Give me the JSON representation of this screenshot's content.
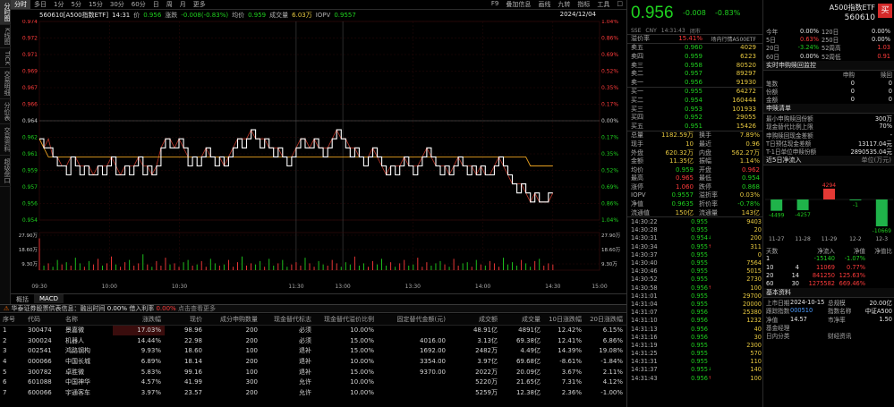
{
  "vtabs": [
    {
      "label": "分时图",
      "active": true
    },
    {
      "label": "K线图",
      "active": false
    },
    {
      "label": "TICK",
      "active": false
    },
    {
      "label": "交易明细",
      "active": false
    },
    {
      "label": "分价表",
      "active": false
    },
    {
      "label": "交易资料",
      "active": false
    },
    {
      "label": "超级盘口",
      "active": false
    }
  ],
  "periods": [
    "分时",
    "多日",
    "1分",
    "5分",
    "15分",
    "30分",
    "60分",
    "日",
    "周",
    "月",
    "更多"
  ],
  "right_tools": [
    "F9",
    "叠加信息",
    "画线",
    "九转",
    "指标",
    "工具",
    "□"
  ],
  "info": {
    "code_name": "560610[A500指数ETF]",
    "time": "14:31",
    "price_label": "价",
    "price": "0.956",
    "change_label": "涨跌",
    "change": "-0.008(-0.83%)",
    "avg_label": "均价",
    "avg": "0.959",
    "volume_label": "成交量",
    "volume": "6.03万",
    "iopv_label": "IOPV",
    "iopv": "0.9557",
    "date": "2024/12/04"
  },
  "chart_data": {
    "type": "line",
    "title": "",
    "prev_close": 0.964,
    "ylim": [
      0.953,
      0.975
    ],
    "y_ticks_left": [
      "0.974",
      "0.972",
      "0.971",
      "0.969",
      "0.967",
      "0.966",
      "0.964",
      "0.962",
      "0.961",
      "0.959",
      "0.957",
      "0.956",
      "0.954"
    ],
    "y_ticks_right": [
      "1.04%",
      "0.86%",
      "0.69%",
      "0.52%",
      "0.35%",
      "0.17%",
      "0.00%",
      "0.17%",
      "0.35%",
      "0.52%",
      "0.69%",
      "0.86%",
      "1.04%"
    ],
    "x_ticks": [
      "09:30",
      "10:00",
      "10:30",
      "11:30",
      "13:00",
      "13:30",
      "14:00",
      "14:30",
      "15:00"
    ],
    "volume_ticks_left": [
      "27.90万",
      "18.60万",
      "9.30万"
    ],
    "volume_ticks_right": [
      "27.90万",
      "18.60万",
      "9.30万"
    ],
    "price_series": [
      0.962,
      0.961,
      0.961,
      0.96,
      0.959,
      0.959,
      0.958,
      0.96,
      0.959,
      0.958,
      0.959,
      0.958,
      0.958,
      0.959,
      0.958,
      0.959,
      0.96,
      0.958,
      0.958,
      0.959,
      0.958,
      0.959,
      0.96,
      0.958,
      0.959,
      0.958,
      0.959,
      0.961,
      0.962,
      0.961,
      0.961,
      0.962,
      0.961,
      0.959,
      0.96,
      0.959,
      0.96,
      0.961,
      0.96,
      0.959,
      0.96,
      0.959,
      0.96,
      0.961,
      0.962,
      0.961,
      0.962,
      0.963,
      0.962,
      0.961,
      0.962,
      0.961,
      0.96,
      0.961,
      0.96,
      0.959,
      0.96,
      0.961,
      0.962,
      0.961,
      0.961,
      0.962,
      0.961,
      0.96,
      0.961,
      0.962,
      0.963,
      0.962,
      0.961,
      0.96,
      0.961,
      0.96,
      0.959,
      0.96,
      0.961,
      0.96,
      0.959,
      0.958,
      0.959,
      0.958,
      0.959,
      0.96,
      0.959,
      0.958,
      0.959,
      0.96,
      0.961,
      0.96,
      0.959,
      0.958,
      0.959,
      0.958,
      0.959,
      0.96,
      0.959,
      0.958,
      0.959,
      0.958,
      0.959,
      0.958,
      0.958,
      0.959,
      0.96,
      0.959,
      0.958,
      0.957,
      0.956,
      0.957,
      0.956,
      0.955,
      0.956,
      0.955,
      0.955,
      0.956,
      0.956
    ],
    "avg_series": [
      0.962,
      0.961,
      0.96,
      0.96,
      0.96,
      0.96,
      0.96,
      0.96,
      0.96,
      0.96,
      0.96,
      0.96,
      0.96,
      0.96,
      0.96,
      0.96,
      0.96,
      0.96,
      0.96,
      0.96,
      0.96,
      0.96,
      0.96,
      0.96,
      0.96,
      0.96,
      0.96,
      0.96,
      0.96,
      0.96,
      0.96,
      0.96,
      0.96,
      0.96,
      0.96,
      0.96,
      0.96,
      0.96,
      0.96,
      0.96,
      0.96,
      0.96,
      0.96,
      0.96,
      0.96,
      0.96,
      0.96,
      0.96,
      0.96,
      0.96,
      0.96,
      0.96,
      0.96,
      0.96,
      0.96,
      0.96,
      0.96,
      0.96,
      0.96,
      0.96,
      0.96,
      0.96,
      0.96,
      0.96,
      0.96,
      0.96,
      0.96,
      0.96,
      0.96,
      0.96,
      0.96,
      0.96,
      0.96,
      0.96,
      0.96,
      0.96,
      0.96,
      0.96,
      0.96,
      0.96,
      0.96,
      0.96,
      0.96,
      0.96,
      0.96,
      0.96,
      0.96,
      0.96,
      0.96,
      0.96,
      0.96,
      0.96,
      0.96,
      0.96,
      0.96,
      0.96,
      0.96,
      0.96,
      0.96,
      0.96,
      0.96,
      0.96,
      0.96,
      0.96,
      0.96,
      0.96,
      0.96,
      0.96,
      0.96,
      0.959,
      0.959,
      0.959,
      0.959,
      0.959,
      0.959
    ],
    "iopv_series": [
      0.962,
      0.961,
      0.962,
      0.96,
      0.96,
      0.959,
      0.959,
      0.96,
      0.96,
      0.959,
      0.959,
      0.959,
      0.958,
      0.959,
      0.959,
      0.959,
      0.96,
      0.959,
      0.958,
      0.959,
      0.959,
      0.959,
      0.96,
      0.959,
      0.959,
      0.958,
      0.959,
      0.961,
      0.962,
      0.962,
      0.961,
      0.962,
      0.961,
      0.96,
      0.96,
      0.96,
      0.96,
      0.961,
      0.96,
      0.96,
      0.96,
      0.959,
      0.96,
      0.961,
      0.962,
      0.962,
      0.962,
      0.963,
      0.962,
      0.962,
      0.962,
      0.961,
      0.961,
      0.961,
      0.96,
      0.96,
      0.96,
      0.961,
      0.962,
      0.962,
      0.961,
      0.962,
      0.961,
      0.961,
      0.961,
      0.962,
      0.963,
      0.962,
      0.962,
      0.961,
      0.961,
      0.96,
      0.96,
      0.96,
      0.961,
      0.96,
      0.959,
      0.958,
      0.959,
      0.959,
      0.959,
      0.96,
      0.959,
      0.959,
      0.959,
      0.96,
      0.961,
      0.96,
      0.959,
      0.959,
      0.959,
      0.958,
      0.959,
      0.96,
      0.959,
      0.959,
      0.959,
      0.958,
      0.959,
      0.958,
      0.958,
      0.959,
      0.96,
      0.959,
      0.958,
      0.957,
      0.957,
      0.957,
      0.956,
      0.955,
      0.956,
      0.955,
      0.955,
      0.955,
      0.956
    ],
    "volume_series": [
      28,
      4,
      6,
      3,
      9,
      5,
      7,
      4,
      11,
      6,
      3,
      8,
      5,
      10,
      4,
      6,
      12,
      5,
      3,
      7,
      9,
      4,
      6,
      14,
      5,
      3,
      8,
      4,
      11,
      5,
      6,
      3,
      7,
      9,
      4,
      5,
      8,
      3,
      10,
      6,
      4,
      5,
      9,
      3,
      7,
      12,
      4,
      6,
      5,
      8,
      3,
      10,
      4,
      6,
      9,
      3,
      5,
      7,
      4,
      11,
      6,
      3,
      8,
      5,
      4,
      9,
      6,
      3,
      7,
      5,
      12,
      4,
      6,
      3,
      8,
      5,
      10,
      4,
      7,
      3,
      6,
      9,
      4,
      5,
      11,
      3,
      7,
      4,
      6,
      8,
      5,
      3,
      10,
      4,
      6,
      7,
      3,
      9,
      5,
      4,
      8,
      6,
      3,
      11,
      5,
      7,
      4,
      9,
      6,
      3,
      8,
      10,
      4,
      6,
      5
    ]
  },
  "bottom_tabs": [
    {
      "label": "概括",
      "active": false
    },
    {
      "label": "MACD",
      "active": true
    }
  ],
  "cons_bar": {
    "title": "华泰证券股票供表信息：融出时间",
    "v1_label": "融出时间",
    "v1": "0.00%",
    "v2_label": "借入利率",
    "v2": "0.00%",
    "v3": "点击查看更多"
  },
  "cons_headers": [
    "序号",
    "代码",
    "名称",
    "涨跌幅",
    "现价",
    "成分申购数量",
    "现金替代标志",
    "现金替代溢价比例",
    "固定替代金额(元)",
    "成交额",
    "成交量",
    "10日涨跌幅",
    "20日涨跌幅"
  ],
  "cons_rows": [
    [
      "1",
      "300474",
      "景嘉微",
      "17.03%",
      "98.96",
      "200",
      "必须",
      "10.00%",
      "",
      "48.91亿",
      "4891亿",
      "12.42%",
      "6.15%"
    ],
    [
      "2",
      "300024",
      "机器人",
      "14.44%",
      "22.98",
      "200",
      "必须",
      "15.00%",
      "4016.00",
      "3.13亿",
      "69.38亿",
      "12.41%",
      "6.86%"
    ],
    [
      "3",
      "002541",
      "鸿路钢构",
      "9.93%",
      "18.60",
      "100",
      "退补",
      "15.00%",
      "1692.00",
      "2482万",
      "4.49亿",
      "14.39%",
      "19.08%"
    ],
    [
      "4",
      "000066",
      "中国长城",
      "6.89%",
      "18.14",
      "200",
      "退补",
      "10.00%",
      "3354.00",
      "3.97亿",
      "69.68亿",
      "-8.61%",
      "-1.84%"
    ],
    [
      "5",
      "300782",
      "卓胜微",
      "5.83%",
      "99.16",
      "100",
      "退补",
      "15.00%",
      "9370.00",
      "2022万",
      "20.09亿",
      "3.67%",
      "2.11%"
    ],
    [
      "6",
      "601088",
      "中国神华",
      "4.57%",
      "41.99",
      "300",
      "允许",
      "10.00%",
      "",
      "5220万",
      "21.65亿",
      "7.31%",
      "4.12%"
    ],
    [
      "7",
      "600066",
      "宇通客车",
      "3.97%",
      "23.57",
      "200",
      "允许",
      "10.00%",
      "",
      "5259万",
      "12.38亿",
      "2.36%",
      "-1.00%"
    ]
  ],
  "quote": {
    "price": "0.956",
    "change": "-0.008",
    "pct": "-0.83%",
    "name": "A500指数ETF",
    "code": "560610",
    "buy_label": "买",
    "meta": [
      "SSE",
      "CNY",
      "14:31:43",
      "闭市"
    ],
    "premium_label": "溢价率",
    "premium": "15.41%",
    "linked_label": "场内行情A500ETF",
    "linked_val": "99131",
    "asks": [
      {
        "label": "卖五",
        "price": "0.960",
        "vol": "4029"
      },
      {
        "label": "卖四",
        "price": "0.959",
        "vol": "6223"
      },
      {
        "label": "卖三",
        "price": "0.958",
        "vol": "80520"
      },
      {
        "label": "卖二",
        "price": "0.957",
        "vol": "89297"
      },
      {
        "label": "卖一",
        "price": "0.956",
        "vol": "91930"
      }
    ],
    "bids": [
      {
        "label": "买一",
        "price": "0.955",
        "vol": "64272"
      },
      {
        "label": "买二",
        "price": "0.954",
        "vol": "160444"
      },
      {
        "label": "买三",
        "price": "0.953",
        "vol": "101933"
      },
      {
        "label": "买四",
        "price": "0.952",
        "vol": "29055"
      },
      {
        "label": "买五",
        "price": "0.951",
        "vol": "15426"
      }
    ],
    "stats": [
      {
        "l1": "总量",
        "v1": "1182.59万",
        "l2": "换手",
        "v2": "7.89%"
      },
      {
        "l1": "现手",
        "v1": "10",
        "l2": "最近",
        "v2": "0.96"
      },
      {
        "l1": "外盘",
        "v1": "620.32万",
        "l2": "内盘",
        "v2": "562.27万"
      },
      {
        "l1": "金额",
        "v1": "11.35亿",
        "l2": "振幅",
        "v2": "1.14%"
      },
      {
        "l1": "均价",
        "v1": "0.959",
        "l2": "开盘",
        "v2": "0.962"
      },
      {
        "l1": "最高",
        "v1": "0.965",
        "l2": "最低",
        "v2": "0.954"
      },
      {
        "l1": "涨停",
        "v1": "1.060",
        "l2": "跌停",
        "v2": "0.868"
      },
      {
        "l1": "IOPV",
        "v1": "0.9557",
        "l2": "溢折率",
        "v2": "0.03%"
      },
      {
        "l1": "净值",
        "v1": "0.9635",
        "l2": "折价率",
        "v2": "-0.78%"
      },
      {
        "l1": "流通值",
        "v1": "150亿",
        "l2": "流通量",
        "v2": "143亿"
      }
    ],
    "ticks": [
      {
        "t": "14:30:22",
        "p": "0.955",
        "v": "9403",
        "d": ""
      },
      {
        "t": "14:30:28",
        "p": "0.955",
        "v": "20",
        "d": ""
      },
      {
        "t": "14:30:31",
        "p": "0.954",
        "v": "200",
        "d": "down"
      },
      {
        "t": "14:30:34",
        "p": "0.955",
        "v": "311",
        "d": "up"
      },
      {
        "t": "14:30:37",
        "p": "0.955",
        "v": "0",
        "d": ""
      },
      {
        "t": "14:30:40",
        "p": "0.955",
        "v": "7564",
        "d": ""
      },
      {
        "t": "14:30:46",
        "p": "0.955",
        "v": "5015",
        "d": ""
      },
      {
        "t": "14:30:52",
        "p": "0.955",
        "v": "2730",
        "d": ""
      },
      {
        "t": "14:30:58",
        "p": "0.956",
        "v": "100",
        "d": "up"
      },
      {
        "t": "14:31:01",
        "p": "0.955",
        "v": "29700",
        "d": ""
      },
      {
        "t": "14:31:04",
        "p": "0.955",
        "v": "20000",
        "d": ""
      },
      {
        "t": "14:31:07",
        "p": "0.956",
        "v": "25380",
        "d": ""
      },
      {
        "t": "14:31:10",
        "p": "0.956",
        "v": "1232",
        "d": ""
      },
      {
        "t": "14:31:13",
        "p": "0.956",
        "v": "40",
        "d": ""
      },
      {
        "t": "14:31:16",
        "p": "0.956",
        "v": "30",
        "d": ""
      },
      {
        "t": "14:31:19",
        "p": "0.955",
        "v": "2300",
        "d": ""
      },
      {
        "t": "14:31:25",
        "p": "0.955",
        "v": "570",
        "d": ""
      },
      {
        "t": "14:31:31",
        "p": "0.955",
        "v": "110",
        "d": ""
      },
      {
        "t": "14:31:37",
        "p": "0.955",
        "v": "140",
        "d": "down"
      },
      {
        "t": "14:31:43",
        "p": "0.956",
        "v": "100",
        "d": "up"
      }
    ]
  },
  "perf": {
    "rows": [
      {
        "a": "今年",
        "b": "0.00%",
        "c": "120日",
        "d": "0.00%"
      },
      {
        "a": "5日",
        "b": "0.63%",
        "c": "250日",
        "d": "0.00%"
      },
      {
        "a": "20日",
        "b": "-3.24%",
        "c": "52周高",
        "d": "1.03"
      },
      {
        "a": "60日",
        "b": "0.00%",
        "c": "52周低",
        "d": "0.91"
      }
    ]
  },
  "flows": {
    "title": "实时申购赎回监控",
    "headers": [
      "",
      "申购",
      "赎回"
    ],
    "rows": [
      {
        "l": "笔数",
        "a": "0",
        "b": "0"
      },
      {
        "l": "份额",
        "a": "0",
        "b": "0"
      },
      {
        "l": "金额",
        "a": "0",
        "b": "0"
      }
    ]
  },
  "subs": {
    "title": "申赎清单",
    "rows": [
      {
        "l": "最小申购赎回份额",
        "v": "300万"
      },
      {
        "l": "现金替代比例上限",
        "v": "70%"
      },
      {
        "l": "申购赎回现金差额",
        "v": "-"
      },
      {
        "l": "T日预估现金差额",
        "v": "13117.04元"
      },
      {
        "l": "T-1日单位申赎份额",
        "v": "2890535.04元"
      }
    ]
  },
  "netflow": {
    "title": "近5日净流入",
    "unit": "单位(万元)",
    "days": [
      "11-27",
      "11-28",
      "11-29",
      "12-2",
      "12-3"
    ],
    "values": [
      -4499,
      -4257,
      4294,
      -1,
      -10669
    ],
    "value_labels": [
      "-4499",
      "-4257",
      "4294",
      "-1",
      "-10669"
    ]
  },
  "stat_table": {
    "headers": [
      "天数",
      "",
      "净流入",
      "净值",
      "净值比"
    ],
    "rows": [
      [
        "1",
        "",
        "-15140",
        "-1.07%",
        ""
      ],
      [
        "10",
        "4",
        "11069",
        "0.77%",
        ""
      ],
      [
        "20",
        "14",
        "841250",
        "125.63%",
        ""
      ],
      [
        "60",
        "30",
        "1275582",
        "669.46%",
        ""
      ]
    ]
  },
  "basic": {
    "title": "基本资料",
    "rows": [
      {
        "l": "上市日期",
        "v": "2024-10-15",
        "l2": "总规模",
        "v2": "20.00亿"
      },
      {
        "l": "跟踪指数",
        "v": "000510",
        "l2": "指数名称",
        "v2": "中证A500"
      },
      {
        "l": "净值",
        "v": "14.57",
        "l2": "市净率",
        "v2": "1.50"
      },
      {
        "l": "基金经理",
        "v": "",
        "l2": "",
        "v2": ""
      }
    ],
    "footer_left": "日内分类",
    "footer_right": "财经资讯"
  }
}
